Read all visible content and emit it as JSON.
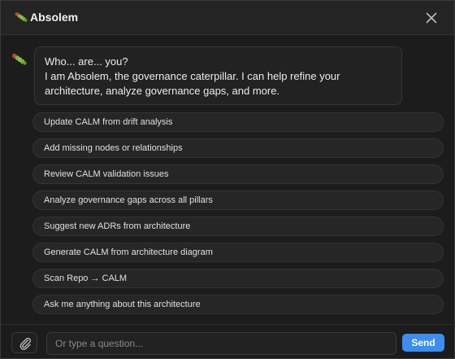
{
  "header": {
    "title": "Absolem",
    "logo_icon": "caterpillar-icon",
    "close_icon": "close-icon"
  },
  "chat": {
    "assistant_icon": "caterpillar-icon",
    "message_line_1": "Who... are... you?",
    "message_line_2": "I am Absolem, the governance caterpillar. I can help refine your architecture, analyze governance gaps, and more."
  },
  "suggestions": [
    "Update CALM from drift analysis",
    "Add missing nodes or relationships",
    "Review CALM validation issues",
    "Analyze governance gaps across all pillars",
    "Suggest new ADRs from architecture",
    "Generate CALM from architecture diagram",
    "Scan Repo → CALM",
    "Ask me anything about this architecture"
  ],
  "composer": {
    "attach_icon": "paperclip-icon",
    "placeholder": "Or type a question...",
    "send_label": "Send"
  },
  "colors": {
    "background": "#1c1c1c",
    "header": "#242424",
    "accent": "#3b8ef0",
    "caterpillar_green": "#7fb23a",
    "caterpillar_red": "#c2412e"
  }
}
